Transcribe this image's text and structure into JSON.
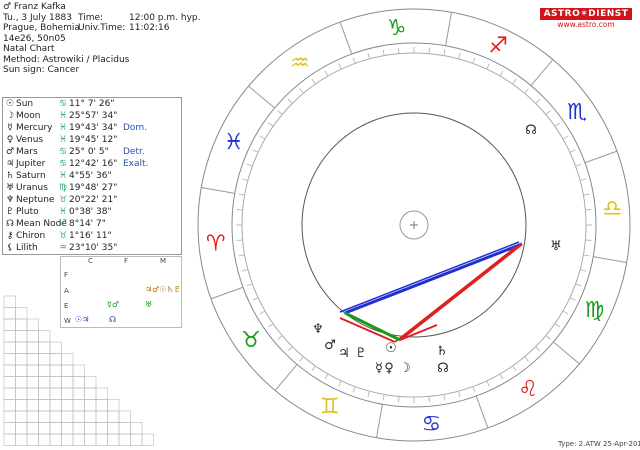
{
  "header": {
    "name": "♂ Franz Kafka",
    "date": "Tu., 3 July 1883",
    "time_label": "Time:",
    "time_value": "12:00 p.m. hyp.",
    "place": "Prague, Bohemia",
    "utime_label": "Univ.Time:",
    "utime_value": "11:02:16",
    "coords": "14e26, 50n05",
    "chart_type": "Natal Chart",
    "method": "Method: Astrowiki / Placidus",
    "sun_sign": "Sun sign: Cancer"
  },
  "logo": {
    "brand": "ASTRO✶DIENST",
    "url": "www.astro.com"
  },
  "planets": [
    {
      "glyph": "☉",
      "name": "Sun",
      "sign": "♋",
      "pos": "11° 7' 26\"",
      "dignity": ""
    },
    {
      "glyph": "☽",
      "name": "Moon",
      "sign": "♓",
      "pos": "25°57' 34\"",
      "dignity": ""
    },
    {
      "glyph": "☿",
      "name": "Mercury",
      "sign": "♓",
      "pos": "19°43' 34\"",
      "dignity": "Dom."
    },
    {
      "glyph": "♀",
      "name": "Venus",
      "sign": "♓",
      "pos": "19°45' 12\"",
      "dignity": ""
    },
    {
      "glyph": "♂",
      "name": "Mars",
      "sign": "♋",
      "pos": "25° 0' 5\"",
      "dignity": "Detr."
    },
    {
      "glyph": "♃",
      "name": "Jupiter",
      "sign": "♋",
      "pos": "12°42' 16\"",
      "dignity": "Exalt."
    },
    {
      "glyph": "♄",
      "name": "Saturn",
      "sign": "♓",
      "pos": "4°55' 36\"",
      "dignity": ""
    },
    {
      "glyph": "♅",
      "name": "Uranus",
      "sign": "♍",
      "pos": "19°48' 27\"",
      "dignity": ""
    },
    {
      "glyph": "♆",
      "name": "Neptune",
      "sign": "♉",
      "pos": "20°22' 21\"",
      "dignity": ""
    },
    {
      "glyph": "♇",
      "name": "Pluto",
      "sign": "♓",
      "pos": "0°38' 38\"",
      "dignity": ""
    },
    {
      "glyph": "☊",
      "name": "Mean Node",
      "sign": "♐",
      "pos": "8°14' 7\"",
      "dignity": ""
    },
    {
      "glyph": "⚷",
      "name": "Chiron",
      "sign": "♉",
      "pos": "1°16' 11\"",
      "dignity": ""
    },
    {
      "glyph": "⚸",
      "name": "Lilith",
      "sign": "♒",
      "pos": "23°10' 35\"",
      "dignity": ""
    }
  ],
  "elements": {
    "cols": [
      "C",
      "F",
      "M"
    ],
    "rows": [
      "F",
      "A",
      "E",
      "W"
    ],
    "cells": [
      {
        "row": 1,
        "col": 2,
        "text": "♃♂☉♄♇"
      },
      {
        "row": 2,
        "col": 1,
        "text": "☿♂"
      },
      {
        "row": 2,
        "col": 2,
        "text": "♅"
      },
      {
        "row": 3,
        "col": 0,
        "text": "☉♃"
      },
      {
        "row": 3,
        "col": 1,
        "text": "☊"
      }
    ]
  },
  "footer": {
    "type": "Type: 2.ATW",
    "date": "25-Apr-2013"
  },
  "colors": {
    "fire": "#e02020",
    "earth": "#1a9a1a",
    "air": "#e0c020",
    "water": "#2030d0",
    "brand": "#d0141c"
  }
}
